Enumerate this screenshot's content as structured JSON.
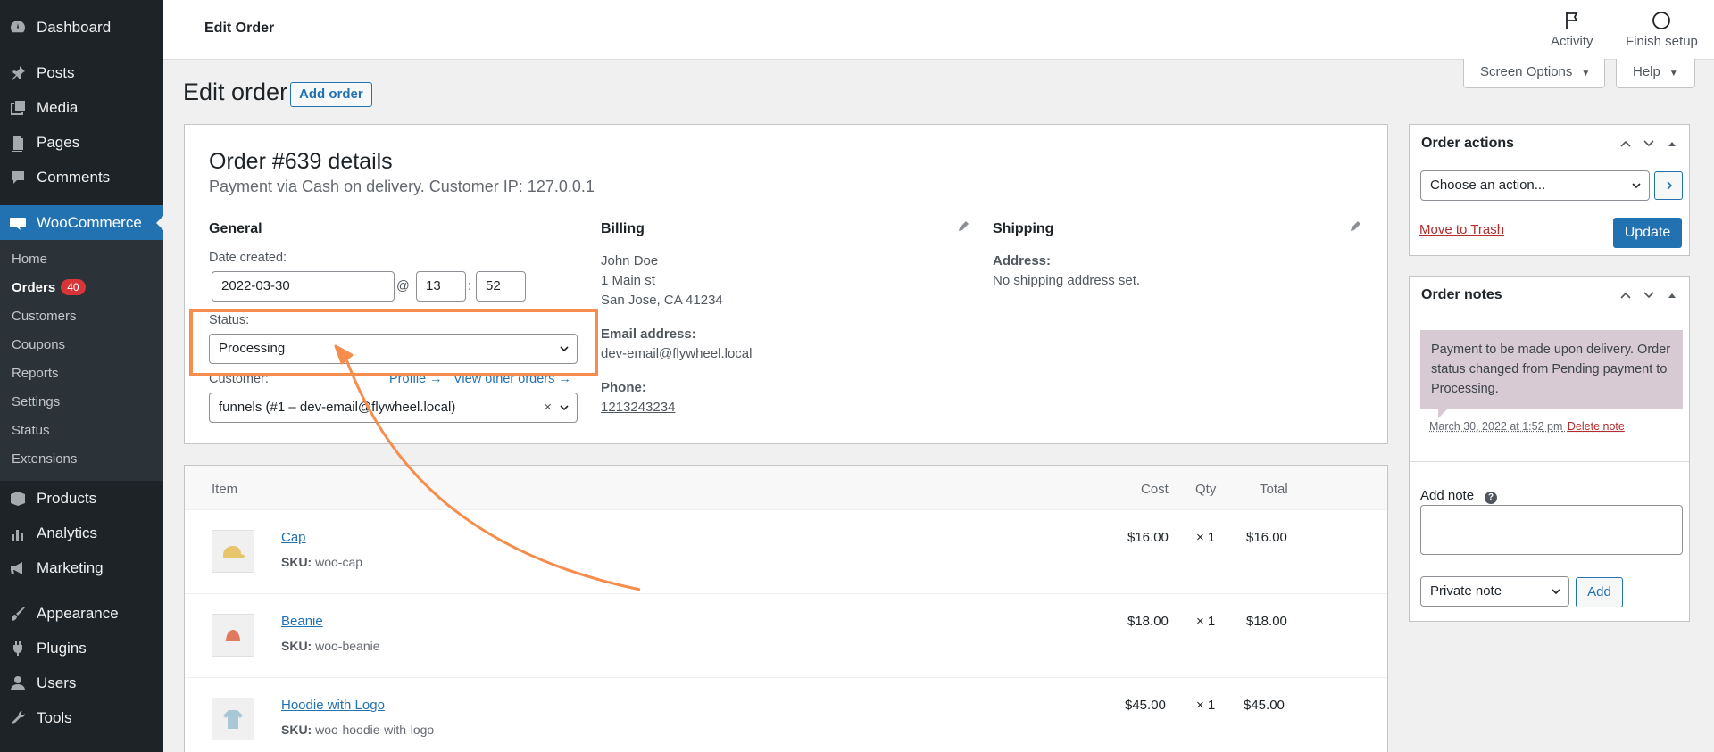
{
  "sidebar": {
    "items_top": [
      {
        "label": "Dashboard",
        "icon": "dashboard-icon"
      },
      {
        "label": "Posts",
        "icon": "pin-icon"
      },
      {
        "label": "Media",
        "icon": "media-icon"
      },
      {
        "label": "Pages",
        "icon": "pages-icon"
      },
      {
        "label": "Comments",
        "icon": "comment-icon"
      },
      {
        "label": "WooCommerce",
        "icon": "woo-icon"
      }
    ],
    "woo_submenu": [
      "Home",
      "Orders",
      "Customers",
      "Coupons",
      "Reports",
      "Settings",
      "Status",
      "Extensions"
    ],
    "orders_badge": "40",
    "items_bottom": [
      {
        "label": "Products",
        "icon": "products-icon"
      },
      {
        "label": "Analytics",
        "icon": "analytics-icon"
      },
      {
        "label": "Marketing",
        "icon": "megaphone-icon"
      },
      {
        "label": "Appearance",
        "icon": "brush-icon"
      },
      {
        "label": "Plugins",
        "icon": "plug-icon"
      },
      {
        "label": "Users",
        "icon": "user-icon"
      },
      {
        "label": "Tools",
        "icon": "wrench-icon"
      }
    ]
  },
  "topbar": {
    "title": "Edit Order",
    "activity": "Activity",
    "finish_setup": "Finish setup",
    "screen_options": "Screen Options",
    "help": "Help"
  },
  "page": {
    "heading": "Edit order",
    "add_order": "Add order"
  },
  "order": {
    "title": "Order #639 details",
    "subtitle": "Payment via Cash on delivery. Customer IP: 127.0.0.1",
    "general": {
      "heading": "General",
      "date_label": "Date created:",
      "date": "2022-03-30",
      "at": "@",
      "hour": "13",
      "colon": ":",
      "minute": "52",
      "status_label": "Status:",
      "status": "Processing",
      "customer_label": "Customer:",
      "profile_link": "Profile →",
      "other_orders_link": "View other orders →",
      "customer": "funnels (#1 – dev-email@flywheel.local)",
      "clear": "×"
    },
    "billing": {
      "heading": "Billing",
      "name": "John Doe",
      "street": "1 Main st",
      "city": "San Jose, CA 41234",
      "email_label": "Email address:",
      "email": "dev-email@flywheel.local",
      "phone_label": "Phone:",
      "phone": "1213243234"
    },
    "shipping": {
      "heading": "Shipping",
      "address_label": "Address:",
      "address": "No shipping address set."
    }
  },
  "items": {
    "headers": {
      "item": "Item",
      "cost": "Cost",
      "qty": "Qty",
      "total": "Total"
    },
    "sku_label": "SKU:",
    "rows": [
      {
        "name": "Cap",
        "sku": "woo-cap",
        "cost": "$16.00",
        "qty": "× 1",
        "total": "$16.00"
      },
      {
        "name": "Beanie",
        "sku": "woo-beanie",
        "cost": "$18.00",
        "qty": "× 1",
        "total": "$18.00"
      },
      {
        "name": "Hoodie with Logo",
        "sku": "woo-hoodie-with-logo",
        "cost": "$45.00",
        "qty": "× 1",
        "total": "$45.00"
      }
    ]
  },
  "order_actions": {
    "title": "Order actions",
    "select": "Choose an action...",
    "trash": "Move to Trash",
    "update": "Update"
  },
  "order_notes": {
    "title": "Order notes",
    "note_text": "Payment to be made upon delivery. Order status changed from Pending payment to Processing.",
    "note_date": "March 30, 2022 at 1:52 pm",
    "delete_note": "Delete note",
    "add_note_label": "Add note",
    "help": "?",
    "note_type": "Private note",
    "add_button": "Add"
  },
  "colors": {
    "accent": "#2271b1",
    "sidebar_bg": "#1d2327",
    "highlight": "#f68d4d",
    "danger": "#d63638"
  }
}
